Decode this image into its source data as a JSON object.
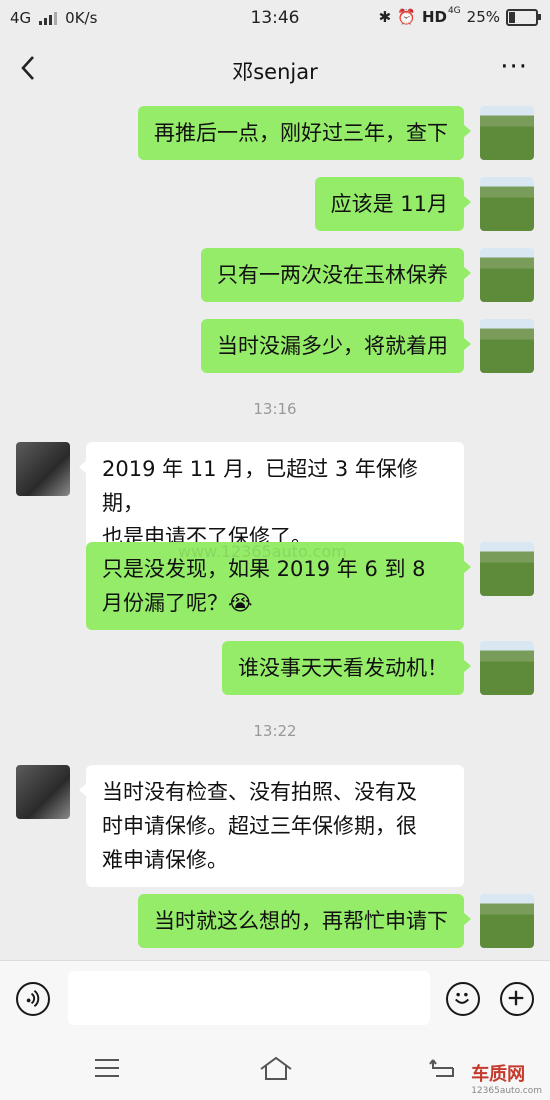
{
  "status_bar": {
    "network": "4G",
    "speed": "0K/s",
    "time": "13:46",
    "hd_label": "HD",
    "hd_network": "4G",
    "battery": "25%",
    "battery_level": 0.25
  },
  "header": {
    "title": "邓senjar",
    "more": "···"
  },
  "messages": [
    {
      "sender": "me",
      "text": "再推后一点，刚好过三年，查下"
    },
    {
      "sender": "me",
      "text": "应该是 11月"
    },
    {
      "sender": "me",
      "text": "只有一两次没在玉林保养"
    },
    {
      "sender": "me",
      "text": "当时没漏多少，将就着用"
    },
    {
      "type": "time",
      "text": "13:16"
    },
    {
      "sender": "them",
      "lines": [
        "2019 年 11 月，已超过 3 年保修期，",
        "也是申请不了保修了。"
      ]
    },
    {
      "sender": "me",
      "lines": [
        "只是没发现，如果 2019 年 6 到 8",
        "月份漏了呢？😭"
      ]
    },
    {
      "sender": "me",
      "text": "谁没事天天看发动机！"
    },
    {
      "type": "time",
      "text": "13:22"
    },
    {
      "sender": "them",
      "lines": [
        "当时没有检查、没有拍照、没有及",
        "时申请保修。超过三年保修期，很",
        "难申请保修。"
      ]
    },
    {
      "sender": "me",
      "text": "当时就这么想的，再帮忙申请下"
    }
  ],
  "watermark": {
    "text": "www.12365auto.com",
    "logo": "车质网",
    "logo_url_text": "12365auto.com"
  },
  "icons": [
    "back-icon",
    "more-icon",
    "voice-icon",
    "emoji-icon",
    "plus-icon",
    "menu-icon",
    "home-icon",
    "return-icon"
  ]
}
